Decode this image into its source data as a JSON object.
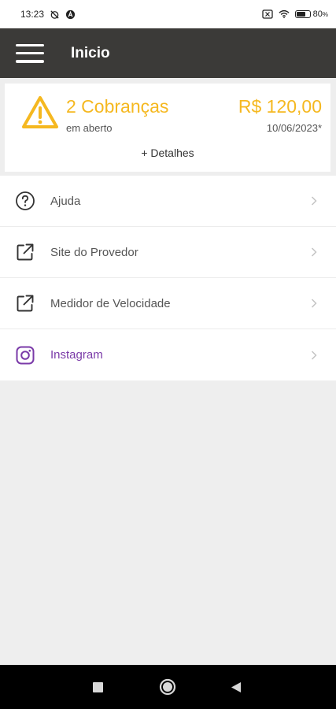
{
  "status_bar": {
    "time": "13:23",
    "battery_percent": "80",
    "battery_unit": "%",
    "battery_level": 0.8,
    "icons_left": [
      "alarm-off-icon",
      "app-notification-icon"
    ],
    "icons_right": [
      "sim-off-icon",
      "wifi-icon",
      "battery-icon"
    ]
  },
  "app_bar": {
    "title": "Inicio",
    "menu_icon": "hamburger-menu-icon",
    "background": "#3b3a38"
  },
  "charges": {
    "count_label": "2 Cobranças",
    "status": "em aberto",
    "amount": "R$ 120,00",
    "due_date": "10/06/2023*",
    "details_link": "+ Detalhes",
    "accent_color": "#f5b820",
    "icon": "warning-icon"
  },
  "menu": {
    "items": [
      {
        "label": "Ajuda",
        "icon": "help-circle-icon"
      },
      {
        "label": "Site do Provedor",
        "icon": "external-link-icon"
      },
      {
        "label": "Medidor de Velocidade",
        "icon": "external-link-icon"
      },
      {
        "label": "Instagram",
        "icon": "instagram-icon",
        "color": "#7a3aa8"
      }
    ]
  },
  "nav_bar": {
    "buttons": [
      "recents-square-icon",
      "home-circle-icon",
      "back-triangle-icon"
    ]
  }
}
